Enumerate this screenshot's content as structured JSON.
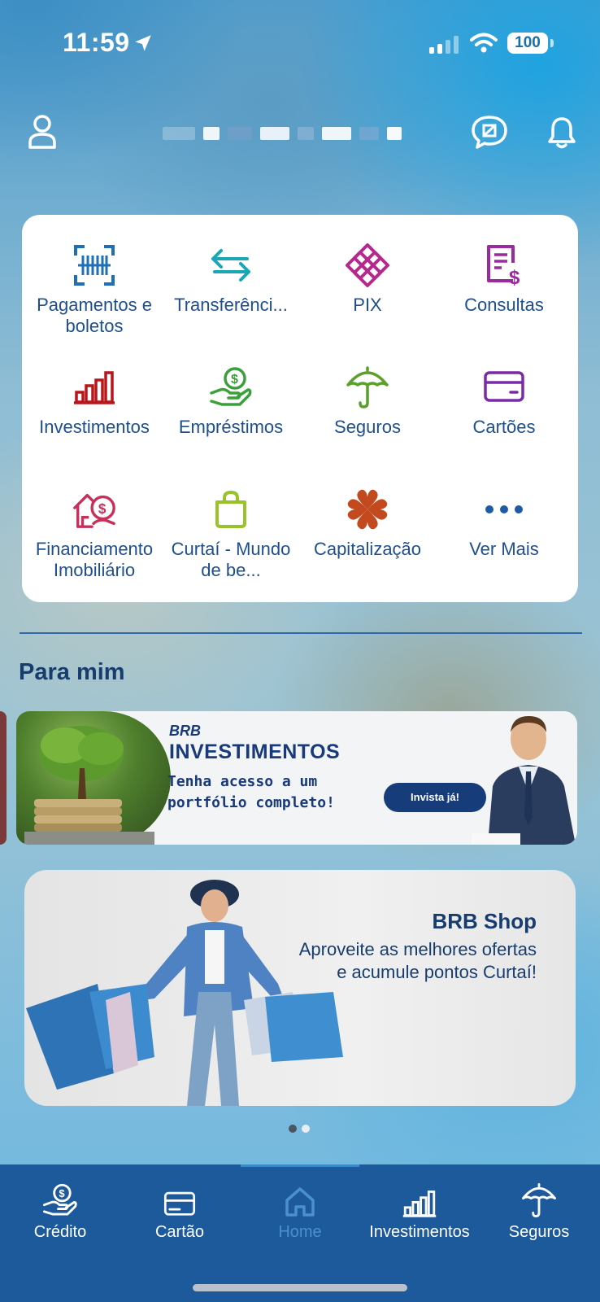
{
  "status_bar": {
    "time": "11:59",
    "battery": "100"
  },
  "header": {
    "user_name_obscured": ""
  },
  "services": [
    {
      "label": "Pagamentos e boletos",
      "icon": "barcode-icon",
      "color": "#1e6fb5"
    },
    {
      "label": "Transferênci...",
      "icon": "transfer-arrows-icon",
      "color": "#19a7b8"
    },
    {
      "label": "PIX",
      "icon": "pix-icon",
      "color": "#b5298f"
    },
    {
      "label": "Consultas",
      "icon": "receipt-icon",
      "color": "#9b2aa0"
    },
    {
      "label": "Investimentos",
      "icon": "bar-chart-icon",
      "color": "#b8161b"
    },
    {
      "label": "Empréstimos",
      "icon": "coin-hand-icon",
      "color": "#3aa03a"
    },
    {
      "label": "Seguros",
      "icon": "umbrella-icon",
      "color": "#5aa02a"
    },
    {
      "label": "Cartões",
      "icon": "card-icon",
      "color": "#7a2aa8"
    },
    {
      "label": "Financiamento Imobiliário",
      "icon": "house-money-icon",
      "color": "#c8305a"
    },
    {
      "label": "Curtaí - Mundo de be...",
      "icon": "shopping-bag-icon",
      "color": "#9ac22a"
    },
    {
      "label": "Capitalização",
      "icon": "clover-icon",
      "color": "#c24a1e"
    },
    {
      "label": "Ver Mais",
      "icon": "more-dots-icon",
      "color": "#1e5aa8"
    }
  ],
  "section": {
    "title": "Para mim"
  },
  "banner_investimentos": {
    "brand": "BRB",
    "title": "INVESTIMENTOS",
    "text": "Tenha acesso a um portfólio completo!",
    "button": "Invista já!"
  },
  "banner_shop": {
    "title": "BRB Shop",
    "text": "Aproveite as melhores ofertas e acumule pontos Curtaí!"
  },
  "carousel": {
    "pages": 2,
    "active": 1
  },
  "tab_bar": {
    "items": [
      {
        "label": "Crédito",
        "icon": "coin-hand-icon"
      },
      {
        "label": "Cartão",
        "icon": "card-icon"
      },
      {
        "label": "Home",
        "icon": "home-icon",
        "active": true
      },
      {
        "label": "Investimentos",
        "icon": "bar-chart-icon"
      },
      {
        "label": "Seguros",
        "icon": "umbrella-icon"
      }
    ]
  }
}
